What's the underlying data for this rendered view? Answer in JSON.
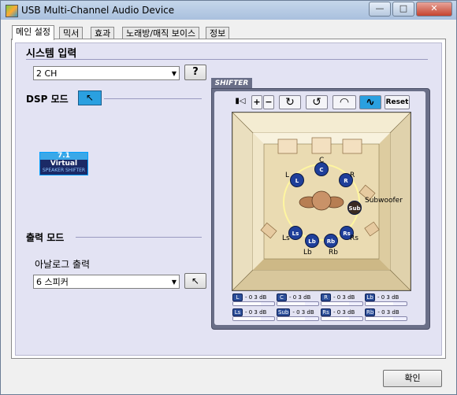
{
  "window": {
    "title": "USB Multi-Channel Audio Device",
    "min_glyph": "—",
    "max_glyph": "□",
    "close_glyph": "✕"
  },
  "tabs": [
    "메인 설정",
    "믹서",
    "효과",
    "노래방/매직 보이스",
    "정보"
  ],
  "active_tab": 0,
  "system_input": {
    "title": "시스템 입력",
    "value": "2 CH",
    "help_label": "?"
  },
  "dsp": {
    "title": "DSP 모드",
    "button_glyph": "↖",
    "virtual_badge": {
      "line1": "7.1",
      "line2": "Virtual",
      "line3": "SPEAKER SHIFTER"
    }
  },
  "output": {
    "title": "출력 모드",
    "analog_label": "아날로그 출력",
    "value": "6 스피커",
    "button_glyph": "↖"
  },
  "shifter": {
    "tab_label": "SHIFTER",
    "tools": {
      "speaker": "▮◁",
      "plus": "+",
      "minus": "−",
      "rotate_cw": "↻",
      "rotate_ccw": "↺",
      "headphone": "◠",
      "wave": "∿",
      "reset": "Reset"
    },
    "speakers": [
      "C",
      "L",
      "R",
      "Subwoofer",
      "Ls",
      "Lb",
      "Rb",
      "Rs"
    ],
    "speaker_codes": [
      "C",
      "L",
      "R",
      "Sub",
      "Ls",
      "Lb",
      "Rb",
      "Rs"
    ],
    "levels": [
      {
        "ch": "L",
        "value": "- 0 3 dB",
        "fraction": 0.68
      },
      {
        "ch": "C",
        "value": "- 0 3 dB",
        "fraction": 0.68
      },
      {
        "ch": "R",
        "value": "- 0 3 dB",
        "fraction": 0.68
      },
      {
        "ch": "Lb",
        "value": "- 0 3 dB",
        "fraction": 0.68
      },
      {
        "ch": "Ls",
        "value": "- 0 3 dB",
        "fraction": 0.68
      },
      {
        "ch": "Sub",
        "value": "- 0 3 dB",
        "fraction": 0.68
      },
      {
        "ch": "Rs",
        "value": "- 0 3 dB",
        "fraction": 0.68
      },
      {
        "ch": "Rb",
        "value": "- 0 3 dB",
        "fraction": 0.68
      }
    ],
    "colors": {
      "speaker": "#1f3f9a",
      "ring": "#fff6a0",
      "sub": "#3a2b22"
    }
  },
  "ok_label": "확인"
}
